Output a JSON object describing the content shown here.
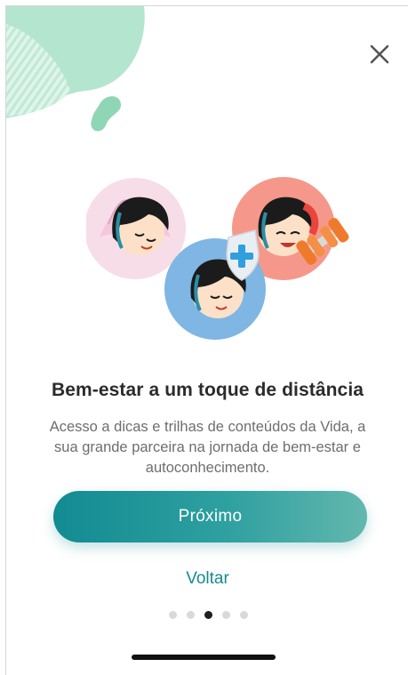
{
  "onboarding": {
    "title": "Bem-estar a um toque de distância",
    "description": "Acesso a dicas e trilhas de conteúdos da Vida, a sua grande parceira na jornada de bem-estar e autoconhecimento.",
    "next_label": "Próximo",
    "back_label": "Voltar",
    "current_page": 3,
    "total_pages": 5
  },
  "icons": {
    "close": "close-icon",
    "illustration": "wellness-characters-illustration"
  },
  "colors": {
    "accent": "#168a8f",
    "button_start": "#128b92",
    "button_end": "#63b7ae",
    "decoration": "#a7e1c7",
    "title": "#2b2b2b",
    "text": "#6e6e6e"
  }
}
